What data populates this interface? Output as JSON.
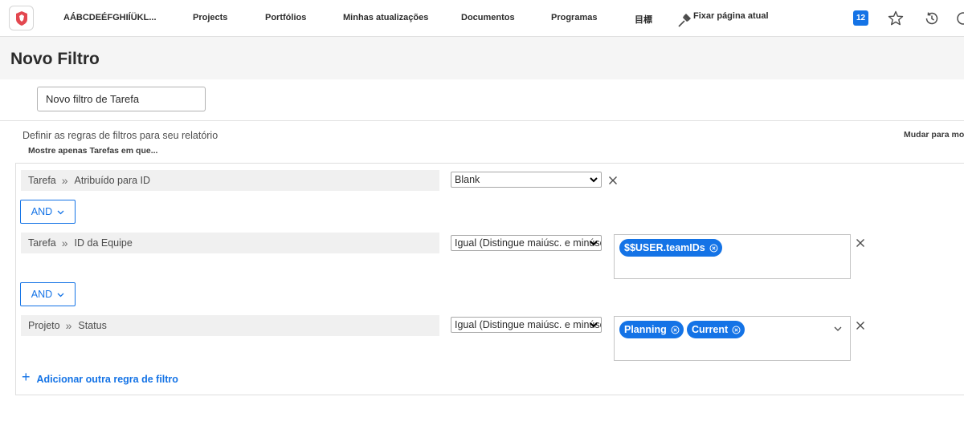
{
  "topnav": {
    "logo_icon": "brand-logo-icon",
    "items": [
      {
        "label": "AÁBCDEÉFGHIÍÜKL..."
      },
      {
        "label": "Projects"
      },
      {
        "label": "Portfólios"
      },
      {
        "label": "Minhas atualizações"
      },
      {
        "label": "Documentos"
      },
      {
        "label": "Programas"
      },
      {
        "label": "目標"
      }
    ],
    "pin_label": "Fixar página atual",
    "notification_count": "12"
  },
  "header": {
    "title": "Novo Filtro"
  },
  "filter_name": {
    "value": "Novo filtro de Tarefa"
  },
  "rules": {
    "description": "Definir as regras de filtros para seu relatório",
    "subheading": "Mostre apenas Tarefas em que...",
    "switch_mode_label": "Mudar para mo",
    "items": [
      {
        "object": "Tarefa",
        "field": "Atribuído para ID",
        "operator": "Blank",
        "values": []
      },
      {
        "object": "Tarefa",
        "field": "ID da Equipe",
        "operator": "Igual (Distingue maiúsc. e minúsc.)",
        "values": [
          "$$USER.teamIDs"
        ]
      },
      {
        "object": "Projeto",
        "field": "Status",
        "operator": "Igual (Distingue maiúsc. e minúsc.)",
        "values": [
          "Planning",
          "Current"
        ]
      }
    ],
    "connectors": [
      "AND",
      "AND"
    ],
    "add_rule_label": "Adicionar outra regra de filtro"
  },
  "colors": {
    "accent": "#1473e6",
    "logo": "#e34850"
  }
}
